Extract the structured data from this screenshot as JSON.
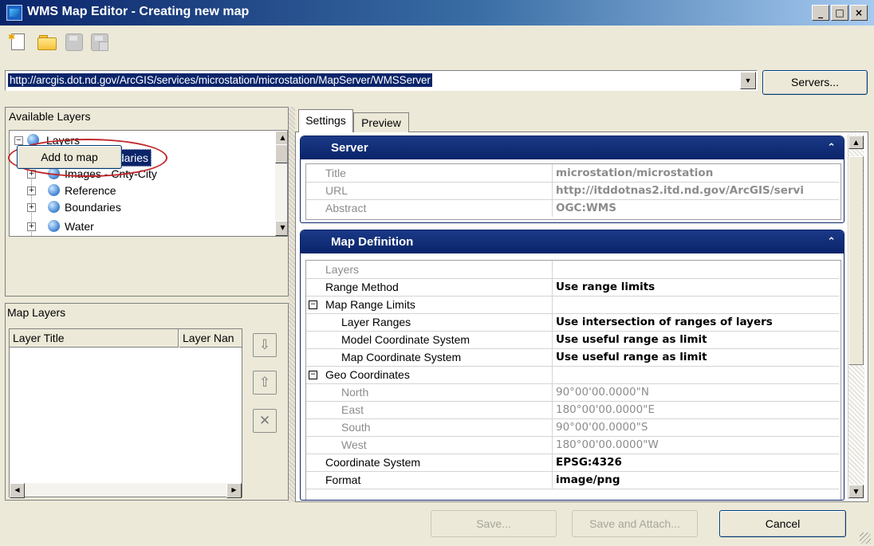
{
  "window": {
    "title": "WMS Map Editor - Creating new map",
    "minimize": "_",
    "maximize": "□",
    "close": "×"
  },
  "toolbar": {
    "icons": [
      "new-icon",
      "open-icon",
      "save-icon",
      "save-as-icon"
    ]
  },
  "server_url": {
    "value": "http://arcgis.dot.nd.gov/ArcGIS/services/microstation/microstation/MapServer/WMSServer",
    "dropdown": "▼",
    "servers_label": "Servers..."
  },
  "available_layers": {
    "title": "Available Layers",
    "tree": [
      {
        "label": "Layers",
        "expander": "−"
      },
      {
        "label": "DOT Boundaries",
        "selected": true
      },
      {
        "label": "Images - Cnty-City",
        "expander": "+"
      },
      {
        "label": "Reference",
        "expander": "+"
      },
      {
        "label": "Boundaries",
        "expander": "+"
      },
      {
        "label": "Water",
        "expander": "+"
      }
    ],
    "add_button": "Add to map"
  },
  "map_layers": {
    "title": "Map Layers",
    "columns": [
      "Layer Title",
      "Layer Nan"
    ],
    "move_down": "⇩",
    "move_up": "⇧",
    "remove": "✕"
  },
  "tabs": [
    "Settings",
    "Preview"
  ],
  "server_section": {
    "title": "Server",
    "chevron": "⌃",
    "rows": [
      {
        "name": "Title",
        "value": "microstation/microstation"
      },
      {
        "name": "URL",
        "value": "http://itddotnas2.itd.nd.gov/ArcGIS/servi"
      },
      {
        "name": "Abstract",
        "value": "OGC:WMS"
      }
    ]
  },
  "map_definition": {
    "title": "Map Definition",
    "chevron": "⌃",
    "rows": [
      {
        "name": "Layers",
        "value": ""
      },
      {
        "name": "Range Method",
        "value": "Use range limits"
      },
      {
        "name": "Map Range Limits",
        "value": "",
        "expander": "−"
      },
      {
        "name": "Layer Ranges",
        "value": "Use intersection of ranges of layers"
      },
      {
        "name": "Model Coordinate System",
        "value": "Use useful range as limit"
      },
      {
        "name": "Map Coordinate System",
        "value": "Use useful range as limit"
      },
      {
        "name": "Geo Coordinates",
        "value": "",
        "expander": "−"
      },
      {
        "name": "North",
        "value": "90°00'00.0000\"N"
      },
      {
        "name": "East",
        "value": "180°00'00.0000\"E"
      },
      {
        "name": "South",
        "value": "90°00'00.0000\"S"
      },
      {
        "name": "West",
        "value": "180°00'00.0000\"W"
      },
      {
        "name": "Coordinate System",
        "value": "EPSG:4326"
      },
      {
        "name": "Format",
        "value": "image/png"
      }
    ]
  },
  "footer": {
    "save": "Save...",
    "save_attach": "Save and Attach...",
    "cancel": "Cancel"
  },
  "colors": {
    "selection": "#0a246a",
    "annotation": "#c0282c"
  }
}
